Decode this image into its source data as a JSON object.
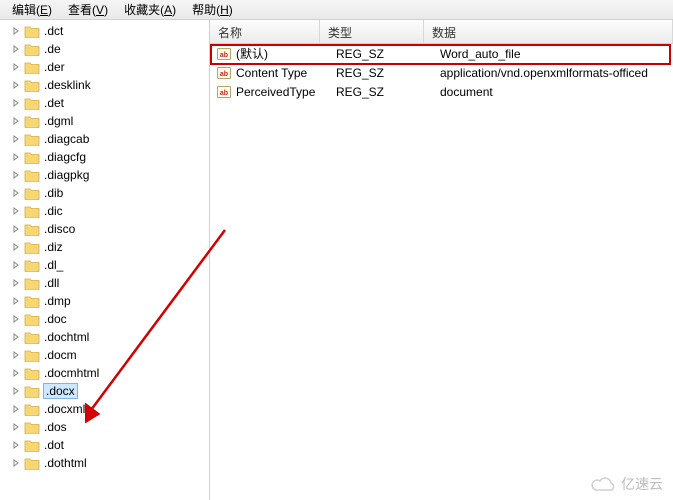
{
  "menu": {
    "items": [
      {
        "label": "编辑",
        "accel": "E"
      },
      {
        "label": "查看",
        "accel": "V"
      },
      {
        "label": "收藏夹",
        "accel": "A"
      },
      {
        "label": "帮助",
        "accel": "H"
      }
    ]
  },
  "tree": {
    "items": [
      ".dct",
      ".de",
      ".der",
      ".desklink",
      ".det",
      ".dgml",
      ".diagcab",
      ".diagcfg",
      ".diagpkg",
      ".dib",
      ".dic",
      ".disco",
      ".diz",
      ".dl_",
      ".dll",
      ".dmp",
      ".doc",
      ".dochtml",
      ".docm",
      ".docmhtml",
      ".docx",
      ".docxml",
      ".dos",
      ".dot",
      ".dothtml"
    ],
    "selected": ".docx"
  },
  "list": {
    "columns": {
      "name": "名称",
      "type": "类型",
      "data": "数据"
    },
    "rows": [
      {
        "name": "(默认)",
        "type": "REG_SZ",
        "data": "Word_auto_file"
      },
      {
        "name": "Content Type",
        "type": "REG_SZ",
        "data": "application/vnd.openxmlformats-officed"
      },
      {
        "name": "PerceivedType",
        "type": "REG_SZ",
        "data": "document"
      }
    ],
    "highlighted_row": 0
  },
  "watermark": "亿速云"
}
